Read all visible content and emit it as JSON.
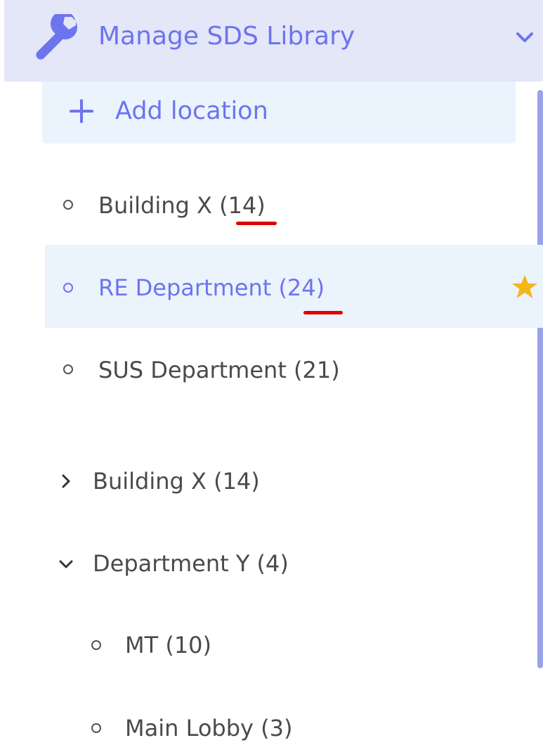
{
  "header": {
    "title": "Manage SDS Library",
    "icon": "wrench-icon",
    "collapse_icon": "chevron-down-icon"
  },
  "add_location": {
    "label": "Add location",
    "icon": "plus-icon"
  },
  "locations": [
    {
      "name": "Building X",
      "count": "(14)"
    },
    {
      "name": "RE Department",
      "count": "(24)",
      "selected": true,
      "favorite": true
    },
    {
      "name": "SUS Department",
      "count": "(21)"
    }
  ],
  "tree": [
    {
      "name": "Building X",
      "count": "(14)",
      "expanded": false
    },
    {
      "name": "Department Y",
      "count": "(4)",
      "expanded": true,
      "children": [
        {
          "name": "MT",
          "count": "(10)"
        },
        {
          "name": "Main Lobby",
          "count": "(3)"
        }
      ]
    }
  ],
  "colors": {
    "accent": "#6d74ee",
    "header_bg": "#e3e7f8",
    "highlight_bg": "#ebf3fd",
    "star": "#f5b51b",
    "annotation": "#e00000"
  }
}
